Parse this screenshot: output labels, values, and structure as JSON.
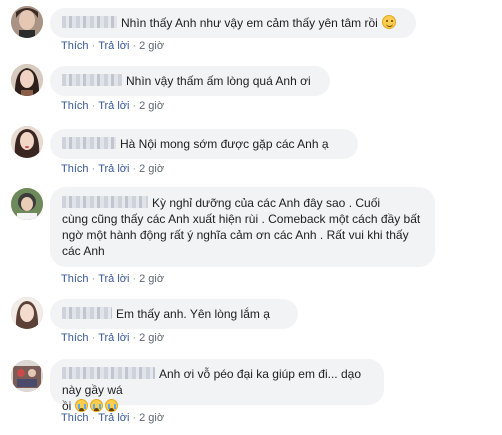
{
  "comments": [
    {
      "name": "",
      "text": "Nhìn thấy Anh như vậy em cảm thấy yên tâm rồi",
      "emoji": "smiling-face-icon",
      "actions": {
        "like": "Thích",
        "reply": "Trả lời",
        "time": "2 giờ"
      }
    },
    {
      "name": "",
      "text": "Nhìn vậy thấm ấm lòng quá Anh ơi",
      "actions": {
        "like": "Thích",
        "reply": "Trả lời",
        "time": "2 giờ"
      }
    },
    {
      "name": "",
      "text": "Hà Nội mong sớm được gặp các Anh ạ",
      "actions": {
        "like": "Thích",
        "reply": "Trả lời",
        "time": "2 giờ"
      }
    },
    {
      "name": "",
      "text_lines": [
        "Kỳ nghỉ dưỡng của các Anh đây sao . Cuối",
        "cùng cũng thấy các Anh xuất hiện rùi . Comeback một cách đầy bất",
        "ngờ một hành động rất ý nghĩa cảm ơn các Anh . Rất vui khi thấy",
        "các Anh"
      ],
      "actions": {
        "like": "Thích",
        "reply": "Trả lời",
        "time": "2 giờ"
      }
    },
    {
      "name": "",
      "text": "Em thấy anh. Yên lòng lắm ạ",
      "actions": {
        "like": "Thích",
        "reply": "Trả lời",
        "time": "2 giờ"
      }
    },
    {
      "name": "",
      "text_lines": [
        "Anh ơi vỗ péo đại ka giúp em đi... dạo này gầy wá",
        "ồi"
      ],
      "emoji": "crying-face-icon",
      "actions": {
        "like": "Thích",
        "reply": "Trả lời",
        "time": "2 giờ"
      }
    }
  ]
}
